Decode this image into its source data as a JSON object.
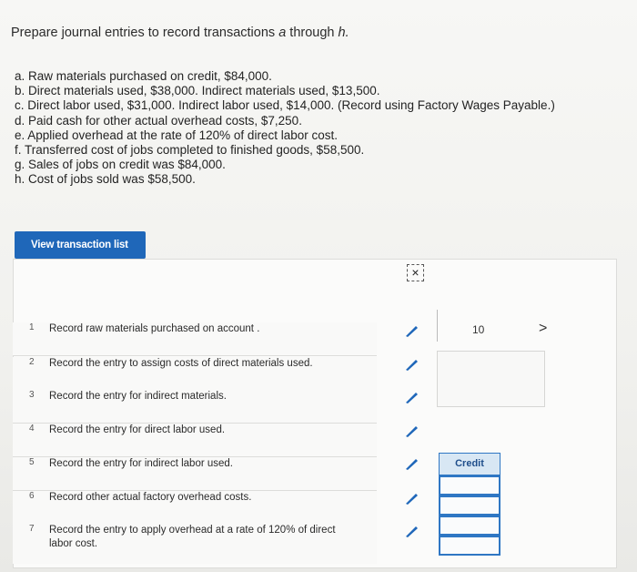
{
  "title": {
    "text": "Prepare journal entries to record transactions ",
    "italic_a": "a",
    "through": " through ",
    "italic_h": "h."
  },
  "transactions": [
    "a. Raw materials purchased on credit, $84,000.",
    "b. Direct materials used, $38,000. Indirect materials used, $13,500.",
    "c. Direct labor used, $31,000. Indirect labor used, $14,000. (Record using Factory Wages Payable.)",
    "d. Paid cash for other actual overhead costs, $7,250.",
    "e. Applied overhead at the rate of 120% of direct labor cost.",
    "f. Transferred cost of jobs completed to finished goods, $58,500.",
    "g. Sales of jobs on credit was $84,000.",
    "h. Cost of jobs sold was $58,500."
  ],
  "view_button": "View transaction list",
  "close_icon": "close-icon",
  "rows": [
    {
      "num": "1",
      "text": "Record raw materials purchased on account ."
    },
    {
      "num": "2",
      "text": "Record the entry to assign costs of direct materials used."
    },
    {
      "num": "3",
      "text": "Record the entry for indirect materials."
    },
    {
      "num": "4",
      "text": "Record the entry for direct labor used."
    },
    {
      "num": "5",
      "text": "Record the entry for indirect labor used."
    },
    {
      "num": "6",
      "text": "Record other actual factory overhead costs."
    },
    {
      "num": "7",
      "text": "Record the entry to apply overhead at a rate of 120% of direct labor cost."
    }
  ],
  "page_number": "10",
  "next_arrow": ">",
  "credit_label": "Credit",
  "colors": {
    "accent": "#1f67b9",
    "pencil": "#1f67b9"
  }
}
